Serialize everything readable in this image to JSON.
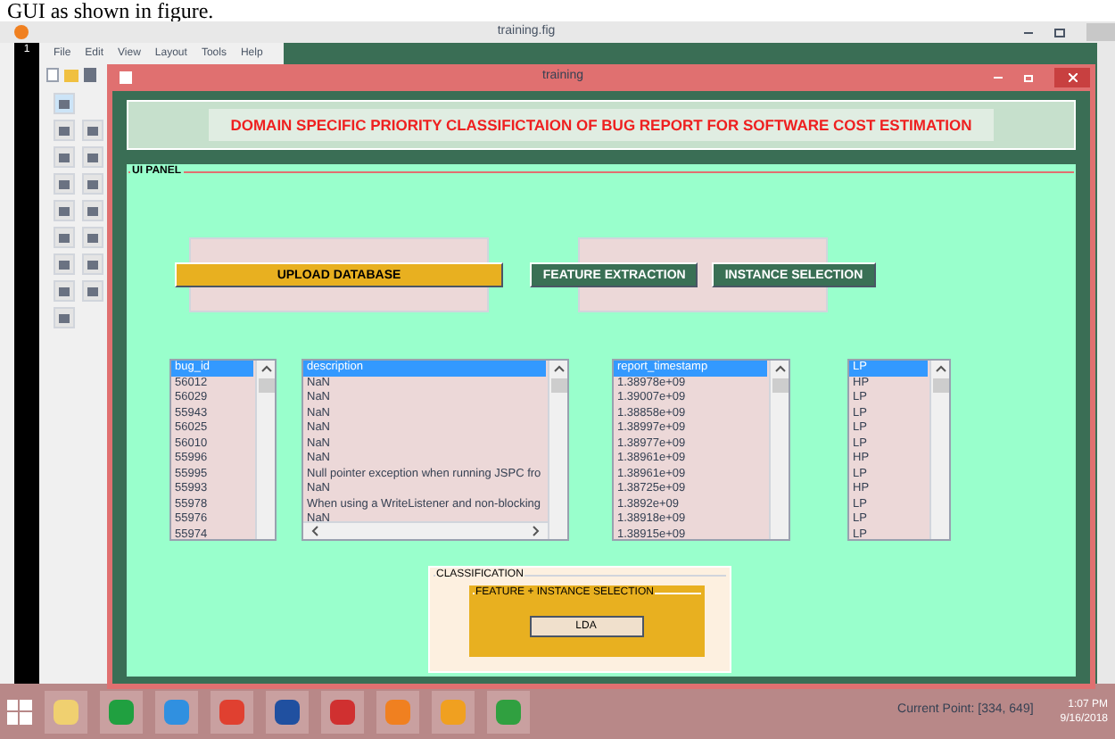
{
  "caption": "GUI as shown in figure.",
  "editor": {
    "title": "training.fig",
    "menu": [
      "File",
      "Edit",
      "View",
      "Layout",
      "Tools",
      "Help"
    ],
    "line_number": "1"
  },
  "window": {
    "title": "training",
    "heading": "DOMAIN SPECIFIC PRIORITY CLASSIFICTAION OF BUG REPORT FOR SOFTWARE COST ESTIMATION"
  },
  "ui_panel": {
    "label": "UI PANEL",
    "buttons": [
      {
        "label": "UPLOAD DATABASE",
        "kind": "orange"
      },
      {
        "label": "FEATURE EXTRACTION",
        "kind": "green"
      },
      {
        "label": "INSTANCE SELECTION",
        "kind": "green"
      }
    ],
    "lists": [
      {
        "hscroll": false,
        "items": [
          {
            "text": "bug_id",
            "selected": true
          },
          {
            "text": "56012",
            "selected": false
          },
          {
            "text": "56029",
            "selected": false
          },
          {
            "text": "55943",
            "selected": false
          },
          {
            "text": "56025",
            "selected": false
          },
          {
            "text": "56010",
            "selected": false
          },
          {
            "text": "55996",
            "selected": false
          },
          {
            "text": "55995",
            "selected": false
          },
          {
            "text": "55993",
            "selected": false
          },
          {
            "text": "55978",
            "selected": false
          },
          {
            "text": "55976",
            "selected": false
          },
          {
            "text": "55974",
            "selected": false
          }
        ]
      },
      {
        "hscroll": true,
        "items": [
          {
            "text": "description",
            "selected": true
          },
          {
            "text": "NaN",
            "selected": false
          },
          {
            "text": "NaN",
            "selected": false
          },
          {
            "text": "NaN",
            "selected": false
          },
          {
            "text": "NaN",
            "selected": false
          },
          {
            "text": "NaN",
            "selected": false
          },
          {
            "text": "NaN",
            "selected": false
          },
          {
            "text": "Null pointer exception when running JSPC fro",
            "selected": false
          },
          {
            "text": "NaN",
            "selected": false
          },
          {
            "text": "When using a WriteListener and non-blocking",
            "selected": false
          },
          {
            "text": "NaN",
            "selected": false
          }
        ]
      },
      {
        "hscroll": false,
        "items": [
          {
            "text": "report_timestamp",
            "selected": true
          },
          {
            "text": "1.38978e+09",
            "selected": false
          },
          {
            "text": "1.39007e+09",
            "selected": false
          },
          {
            "text": "1.38858e+09",
            "selected": false
          },
          {
            "text": "1.38997e+09",
            "selected": false
          },
          {
            "text": "1.38977e+09",
            "selected": false
          },
          {
            "text": "1.38961e+09",
            "selected": false
          },
          {
            "text": "1.38961e+09",
            "selected": false
          },
          {
            "text": "1.38725e+09",
            "selected": false
          },
          {
            "text": "1.3892e+09",
            "selected": false
          },
          {
            "text": "1.38918e+09",
            "selected": false
          },
          {
            "text": "1.38915e+09",
            "selected": false
          }
        ]
      },
      {
        "hscroll": false,
        "items": [
          {
            "text": "LP",
            "selected": true
          },
          {
            "text": "HP",
            "selected": false
          },
          {
            "text": "LP",
            "selected": false
          },
          {
            "text": "LP",
            "selected": false
          },
          {
            "text": "LP",
            "selected": false
          },
          {
            "text": "LP",
            "selected": false
          },
          {
            "text": "HP",
            "selected": false
          },
          {
            "text": "LP",
            "selected": false
          },
          {
            "text": "HP",
            "selected": false
          },
          {
            "text": "LP",
            "selected": false
          },
          {
            "text": "LP",
            "selected": false
          },
          {
            "text": "LP",
            "selected": false
          }
        ]
      }
    ],
    "classification": {
      "label": "CLASSIFICATION",
      "inner_label": "FEATURE + INSTANCE SELECTION",
      "button": "LDA"
    }
  },
  "status": {
    "current_point": "Current Point: [334, 649]",
    "time": "1:07 PM",
    "date": "9/16/2018"
  }
}
